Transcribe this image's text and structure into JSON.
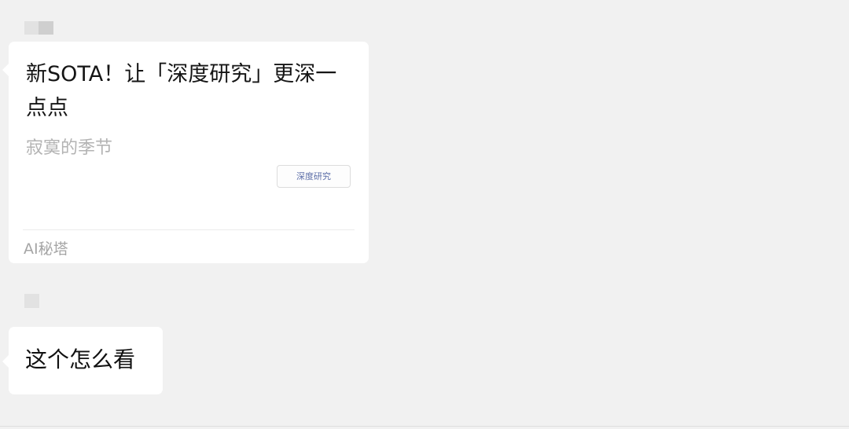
{
  "messages": [
    {
      "type": "link_card",
      "title": "新SOTA！让「深度研究」更深一点点",
      "author": "寂寞的季节",
      "tag": "深度研究",
      "source": "AI秘塔"
    },
    {
      "type": "text",
      "text": "这个怎么看"
    }
  ]
}
